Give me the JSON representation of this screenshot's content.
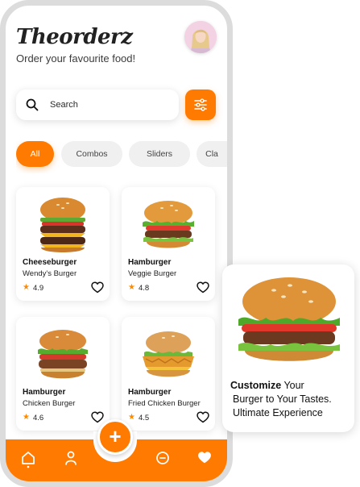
{
  "header": {
    "app_name": "Theorderz",
    "subtitle": "Order your favourite food!"
  },
  "search": {
    "placeholder": "Search",
    "icon": "search-icon"
  },
  "filter": {
    "icon": "sliders-icon"
  },
  "categories": [
    "All",
    "Combos",
    "Sliders",
    "Cla"
  ],
  "active_category": "All",
  "products": [
    {
      "name": "Cheeseburger",
      "restaurant": "Wendy's Burger",
      "rating": "4.9"
    },
    {
      "name": "Hamburger",
      "restaurant": "Veggie Burger",
      "rating": "4.8"
    },
    {
      "name": "Hamburger",
      "restaurant": "Chicken Burger",
      "rating": "4.6"
    },
    {
      "name": "Hamburger",
      "restaurant": "Fried Chicken Burger",
      "rating": "4.5"
    }
  ],
  "nav": {
    "items": [
      "home-icon",
      "profile-icon",
      "chat-icon",
      "heart-icon"
    ],
    "fab": "+"
  },
  "promo": {
    "bold": "Customize",
    "line1_rest": " Your",
    "line2": "Burger to Your Tastes.",
    "line3": "Ultimate Experience"
  },
  "colors": {
    "accent": "#ff7a00",
    "chip_bg": "#f0f0f0",
    "star": "#ff8a00"
  }
}
